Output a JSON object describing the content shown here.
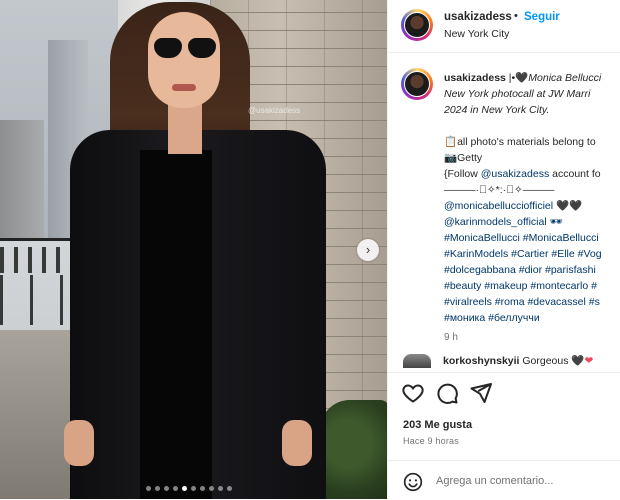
{
  "photo": {
    "watermark": "@usakizadess",
    "carousel": {
      "total_slides": 10,
      "current_index": 4
    }
  },
  "header": {
    "username": "usakizadess",
    "separator": "•",
    "follow_label": "Seguir",
    "location": "New York City"
  },
  "caption": {
    "lines": [
      "usakizadess |•🖤Monica Bellucci",
      "New York photocall at JW Marri",
      "2024 in New York City.",
      "",
      "📋all photo's materials belong to",
      "📷Getty",
      "{Follow @usakizadess account fo",
      "———·ﾟ✧*:·ﾟ✧———",
      "@monicabellucciofficiel 🖤🖤",
      "@karinmodels_official 🕶",
      "#MonicaBellucci #MonicaBellucci",
      "#KarinModels #Cartier #Elle #Vog",
      "#dolcegabbana #dior #parisfashi",
      "#beauty #makeup #montecarlo #",
      "#viralreels #roma #devacassel #s",
      "#моника #беллуччи"
    ],
    "time": "9 h"
  },
  "comment": {
    "username": "korkoshynskyii",
    "text": "Gorgeous 🖤",
    "heart": "❤"
  },
  "actions": {
    "like_icon": "heart-outline-icon",
    "comment_icon": "comment-bubble-icon",
    "share_icon": "paper-plane-icon"
  },
  "likes": "203 Me gusta",
  "posted_ago": "Hace 9 horas",
  "add_comment": {
    "placeholder": "Agrega un comentario..."
  },
  "colors": {
    "link": "#00376b",
    "follow": "#0095f6",
    "muted": "#737373"
  }
}
